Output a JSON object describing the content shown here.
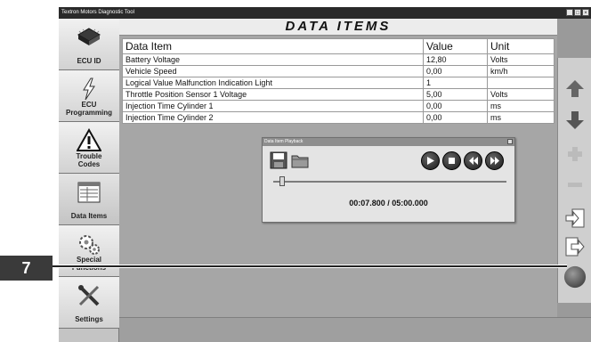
{
  "window": {
    "title": "Textron Motors Diagnostic Tool",
    "controls": [
      "_",
      "□",
      "×"
    ]
  },
  "sidebar": {
    "items": [
      {
        "label": "ECU ID",
        "icon": "chip-icon"
      },
      {
        "label": "ECU\nProgramming",
        "icon": "lightning-icon"
      },
      {
        "label": "Trouble\nCodes",
        "icon": "warning-icon"
      },
      {
        "label": "Data Items",
        "icon": "data-list-icon"
      },
      {
        "label": "Special\nFunctions",
        "icon": "gears-icon"
      },
      {
        "label": "Settings",
        "icon": "wrench-screwdriver-icon"
      }
    ]
  },
  "main": {
    "header": "DATA ITEMS",
    "table": {
      "columns": [
        "Data Item",
        "Value",
        "Unit"
      ],
      "rows": [
        [
          "Battery Voltage",
          "12,80",
          "Volts"
        ],
        [
          "Vehicle Speed",
          "0,00",
          "km/h"
        ],
        [
          "Logical Value Malfunction Indication Light",
          "1",
          ""
        ],
        [
          "Throttle Position Sensor 1 Voltage",
          "5,00",
          "Volts"
        ],
        [
          "Injection Time Cylinder 1",
          "0,00",
          "ms"
        ],
        [
          "Injection Time Cylinder 2",
          "0,00",
          "ms"
        ]
      ]
    }
  },
  "playback": {
    "title": "Data Item Playback",
    "position_fraction": 0.026,
    "time_readout": "00:07.800 / 05:00.000"
  },
  "rightbar": {
    "buttons": [
      "arrow-up-icon",
      "arrow-down-icon",
      "plus-icon",
      "minus-icon",
      "import-icon",
      "export-icon",
      "record-icon"
    ]
  },
  "callout": {
    "number": "7"
  },
  "colors": {
    "callout_bg": "#3a3a3a",
    "app_bg": "#9a9a9a"
  }
}
